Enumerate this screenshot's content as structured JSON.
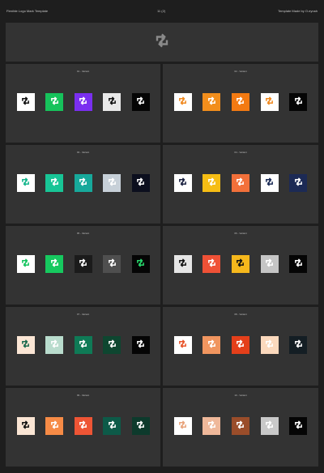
{
  "header": {
    "left": "Flexible Logo Mark Template",
    "center": "11 (2)",
    "right": "Template Made by O.eynah"
  },
  "hero": {
    "icon": "decentraland-arrows-icon",
    "color": "#8a8a8a"
  },
  "panels": [
    {
      "label": "01 - Variant",
      "tiles": [
        {
          "bg": "#ffffff",
          "fg": "#111111"
        },
        {
          "bg": "#16c25b",
          "fg": "#ffffff"
        },
        {
          "bg": "#7a2ff0",
          "fg": "#ffffff"
        },
        {
          "bg": "#e9e9e9",
          "fg": "#111111"
        },
        {
          "bg": "#050505",
          "fg": "#ffffff"
        }
      ]
    },
    {
      "label": "02 - Variant",
      "tiles": [
        {
          "bg": "#ffffff",
          "fg": "#f0891f"
        },
        {
          "bg": "#f28e1c",
          "fg": "#ffffff"
        },
        {
          "bg": "#f37a12",
          "fg": "#ffffff"
        },
        {
          "bg": "#ffffff",
          "fg": "#f0891f"
        },
        {
          "bg": "#050505",
          "fg": "#ffffff"
        }
      ]
    },
    {
      "label": "03 - Variant",
      "tiles": [
        {
          "bg": "#ffffff",
          "fg": "#14b58c"
        },
        {
          "bg": "#18c596",
          "fg": "#ffffff"
        },
        {
          "bg": "#17a99b",
          "fg": "#ffffff"
        },
        {
          "bg": "#c7d0d8",
          "fg": "#ffffff"
        },
        {
          "bg": "#0c0f1e",
          "fg": "#ffffff"
        }
      ]
    },
    {
      "label": "04 - Variant",
      "tiles": [
        {
          "bg": "#ffffff",
          "fg": "#1a2140"
        },
        {
          "bg": "#f6bd14",
          "fg": "#ffffff"
        },
        {
          "bg": "#f2703a",
          "fg": "#ffffff"
        },
        {
          "bg": "#ffffff",
          "fg": "#1a2a55"
        },
        {
          "bg": "#1c2a55",
          "fg": "#ffffff"
        }
      ]
    },
    {
      "label": "05 - Variant",
      "tiles": [
        {
          "bg": "#ffffff",
          "fg": "#15c45f"
        },
        {
          "bg": "#16c95f",
          "fg": "#ffffff"
        },
        {
          "bg": "#1b1b1b",
          "fg": "#ffffff"
        },
        {
          "bg": "#4f4f4f",
          "fg": "#ffffff"
        },
        {
          "bg": "#050505",
          "fg": "#27d66b"
        }
      ]
    },
    {
      "label": "06 - Variant",
      "tiles": [
        {
          "bg": "#e6e6e6",
          "fg": "#111111"
        },
        {
          "bg": "#ef5136",
          "fg": "#ffffff"
        },
        {
          "bg": "#f6b81c",
          "fg": "#111111"
        },
        {
          "bg": "#c5c5c5",
          "fg": "#ffffff"
        },
        {
          "bg": "#050505",
          "fg": "#ffffff"
        }
      ]
    },
    {
      "label": "07 - Variant",
      "tiles": [
        {
          "bg": "#fbe6d5",
          "fg": "#1a6b4f"
        },
        {
          "bg": "#b9dccd",
          "fg": "#ffffff"
        },
        {
          "bg": "#0f7a56",
          "fg": "#ffffff"
        },
        {
          "bg": "#0e4630",
          "fg": "#ffffff"
        },
        {
          "bg": "#050505",
          "fg": "#ffffff"
        }
      ]
    },
    {
      "label": "08 - Variant",
      "tiles": [
        {
          "bg": "#ffffff",
          "fg": "#e8542a"
        },
        {
          "bg": "#f0955f",
          "fg": "#ffffff"
        },
        {
          "bg": "#e43f1a",
          "fg": "#ffffff"
        },
        {
          "bg": "#fbd9bd",
          "fg": "#ffffff"
        },
        {
          "bg": "#141e24",
          "fg": "#ffffff"
        }
      ]
    },
    {
      "label": "09 - Variant",
      "tiles": [
        {
          "bg": "#fae5d4",
          "fg": "#111111"
        },
        {
          "bg": "#f68b46",
          "fg": "#ffffff"
        },
        {
          "bg": "#ee5535",
          "fg": "#ffffff"
        },
        {
          "bg": "#0d5a48",
          "fg": "#ffffff"
        },
        {
          "bg": "#0d3a2c",
          "fg": "#ffffff"
        }
      ]
    },
    {
      "label": "10 - Variant",
      "tiles": [
        {
          "bg": "#ffffff",
          "fg": "#e8a37b"
        },
        {
          "bg": "#efb89a",
          "fg": "#ffffff"
        },
        {
          "bg": "#9a4d2a",
          "fg": "#ffffff"
        },
        {
          "bg": "#c9c9c9",
          "fg": "#ffffff"
        },
        {
          "bg": "#050505",
          "fg": "#ffffff"
        }
      ]
    }
  ]
}
